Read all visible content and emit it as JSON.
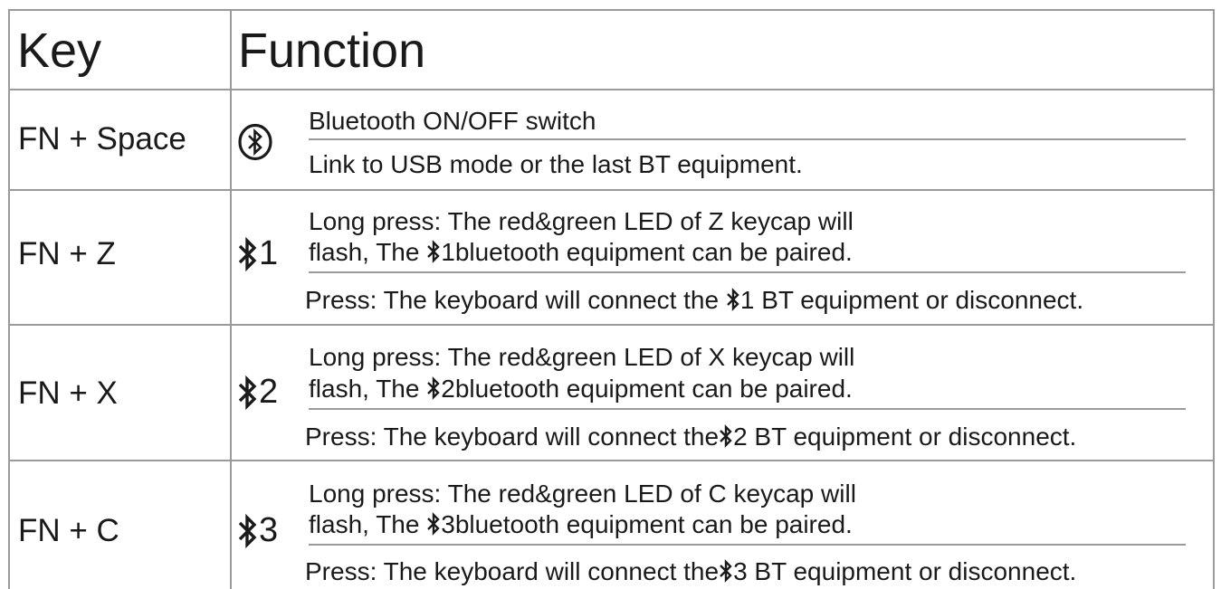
{
  "table": {
    "header": {
      "key": "Key",
      "function": "Function"
    },
    "rows": [
      {
        "key": "FN + Space",
        "icon": "bluetooth-circle-icon",
        "line1": "Bluetooth ON/OFF switch",
        "line2": "Link to USB mode or the last BT equipment."
      },
      {
        "key": "FN + Z",
        "icon": "bluetooth-1-icon",
        "icon_label": "1",
        "long_a": "Long press: The red&green LED of  Z  keycap will",
        "long_b_pre": "flash, The ",
        "long_b_num": "1",
        "long_b_post": "bluetooth equipment can be paired.",
        "press_pre": "Press: The keyboard will connect the ",
        "press_num": "1",
        "press_post": " BT equipment or disconnect."
      },
      {
        "key": "FN + X",
        "icon": "bluetooth-2-icon",
        "icon_label": "2",
        "long_a": "Long press: The red&green LED of  X  keycap will",
        "long_b_pre": "flash, The ",
        "long_b_num": "2",
        "long_b_post": "bluetooth equipment can be paired.",
        "press_pre": "Press: The keyboard will connect the",
        "press_num": "2",
        "press_post": " BT equipment or disconnect."
      },
      {
        "key": "FN + C",
        "icon": "bluetooth-3-icon",
        "icon_label": "3",
        "long_a": "Long press: The red&green LED of  C  keycap will",
        "long_b_pre": "flash, The ",
        "long_b_num": "3",
        "long_b_post": "bluetooth equipment can be paired.",
        "press_pre": "Press: The keyboard will connect the",
        "press_num": "3",
        "press_post": " BT equipment or disconnect."
      }
    ]
  }
}
